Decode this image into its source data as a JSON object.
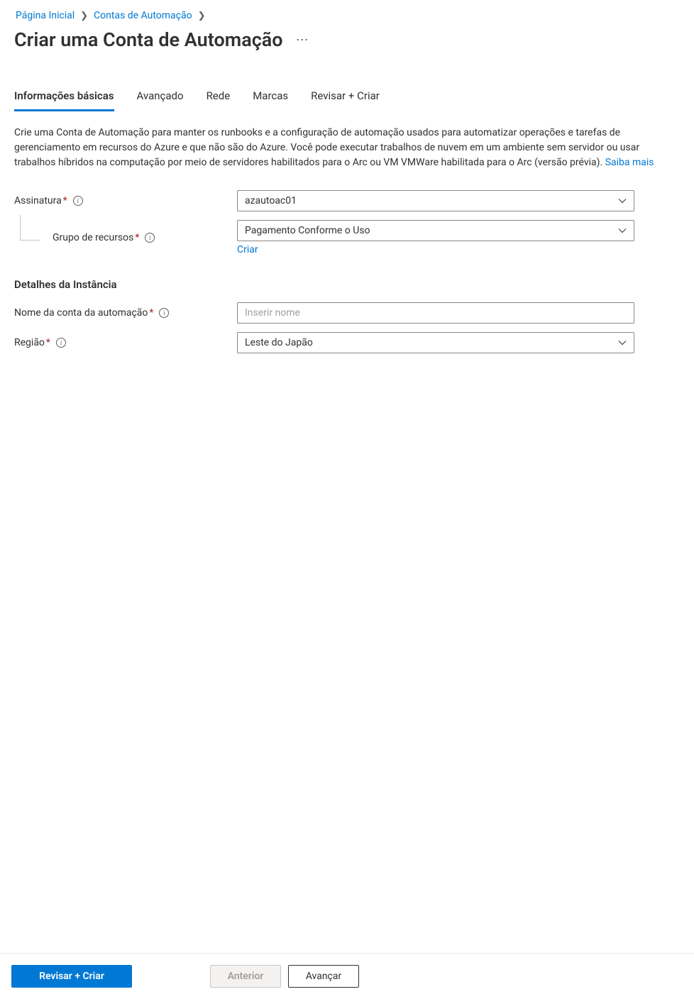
{
  "breadcrumb": {
    "items": [
      "Página Inicial",
      "Contas de Automação"
    ]
  },
  "page_title": "Criar uma Conta de Automação",
  "tabs": {
    "items": [
      {
        "label": "Informações básicas",
        "active": true
      },
      {
        "label": "Avançado",
        "active": false
      },
      {
        "label": "Rede",
        "active": false
      },
      {
        "label": "Marcas",
        "active": false
      },
      {
        "label": "Revisar + Criar",
        "active": false
      }
    ]
  },
  "description": {
    "text": "Crie uma Conta de Automação para manter os runbooks e a configuração de automação usados para automatizar operações e tarefas de gerenciamento em recursos do Azure e que não são do Azure. Você pode executar trabalhos de nuvem em um ambiente sem servidor ou usar trabalhos híbridos na computação por meio de servidores habilitados para o Arc ou VM VMWare habilitada para o Arc (versão prévia). ",
    "link_text": "Saiba mais"
  },
  "form": {
    "subscription": {
      "label": "Assinatura",
      "value": "azautoac01"
    },
    "resource_group": {
      "label": "Grupo de recursos",
      "value": "Pagamento Conforme o Uso",
      "create_link": "Criar"
    },
    "instance_heading": "Detalhes da Instância",
    "account_name": {
      "label": "Nome da conta da automação",
      "placeholder": "Inserir nome",
      "value": ""
    },
    "region": {
      "label": "Região",
      "value": "Leste do Japão"
    }
  },
  "footer": {
    "review_create": "Revisar + Criar",
    "previous": "Anterior",
    "next": "Avançar"
  }
}
